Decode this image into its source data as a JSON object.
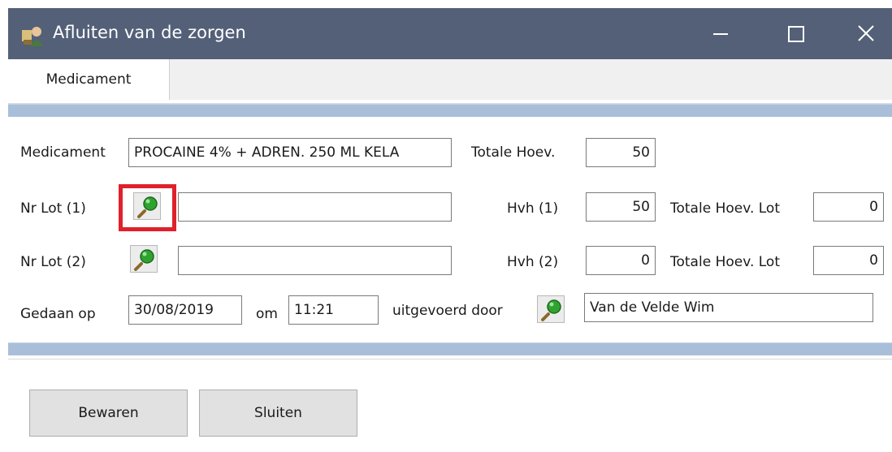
{
  "window": {
    "title": "Afluiten van de zorgen"
  },
  "tabs": [
    {
      "label": "Medicament"
    }
  ],
  "form": {
    "medicament": {
      "label": "Medicament",
      "value": "PROCAINE 4% + ADREN. 250 ML KELA"
    },
    "totale_hoev": {
      "label": "Totale Hoev.",
      "value": "50"
    },
    "lot1": {
      "label": "Nr Lot (1)",
      "value": "",
      "hvh_label": "Hvh (1)",
      "hvh_value": "50",
      "totale_label": "Totale Hoev. Lot",
      "totale_value": "0"
    },
    "lot2": {
      "label": "Nr Lot (2)",
      "value": "",
      "hvh_label": "Hvh (2)",
      "hvh_value": "0",
      "totale_label": "Totale Hoev. Lot",
      "totale_value": "0"
    },
    "gedaan_op": {
      "label": "Gedaan op",
      "date": "30/08/2019",
      "om_label": "om",
      "time": "11:21"
    },
    "uitgevoerd": {
      "label": "uitgevoerd door",
      "value": "Van de Velde Wim"
    }
  },
  "buttons": {
    "save": "Bewaren",
    "close": "Sluiten"
  },
  "colors": {
    "titlebar": "#536078",
    "section_bar": "#a9bfd9",
    "highlight": "#e0202a"
  }
}
